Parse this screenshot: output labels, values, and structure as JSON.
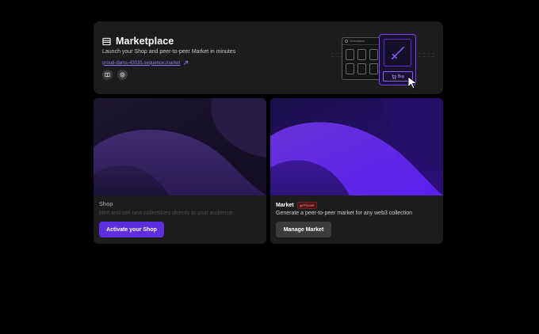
{
  "hero": {
    "title": "Marketplace",
    "subtitle": "Launch your Shop and peer-to-peer Market in minutes",
    "link": "proud-dams-43035.sequence.market",
    "icons": [
      "storefront-icon",
      "external-link-icon",
      "book-icon",
      "globe-icon"
    ]
  },
  "illustration": {
    "window_label": "Marketplace",
    "buy_label": "Buy"
  },
  "shop_card": {
    "title": "Shop",
    "description": "Mint and sell new collectibles directly to your audience",
    "button": "Activate your Shop"
  },
  "market_card": {
    "title": "Market",
    "badge": "Private",
    "description": "Generate a peer-to-peer market for any web3 collection",
    "button": "Manage Market"
  },
  "colors": {
    "accent": "#5b2fe0",
    "purple_glow": "#7b3fff",
    "card_bg": "#1c1c1c",
    "badge_red": "#ff7a7a"
  }
}
